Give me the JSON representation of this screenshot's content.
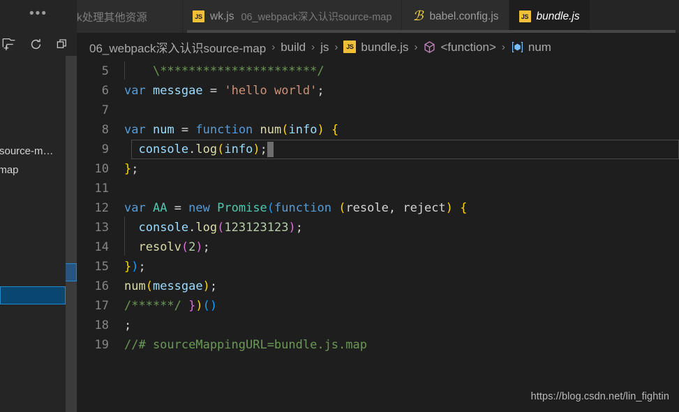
{
  "window": {
    "watermark": "https://blog.csdn.net/lin_fightin"
  },
  "tabbar": {
    "overflow_label": "…",
    "tabs": [
      {
        "icon": "none",
        "label": "k处理其他资源",
        "description": "",
        "active": false,
        "truncated": true
      },
      {
        "icon": "js-file-icon",
        "label": "wk.js",
        "description": "06_webpack深入认识source-map",
        "active": false,
        "truncated": false
      },
      {
        "icon": "babel-file-icon",
        "label": "babel.config.js",
        "description": "",
        "active": false,
        "truncated": false
      },
      {
        "icon": "js-file-icon",
        "label": "bundle.js",
        "description": "",
        "active": true,
        "truncated": true
      }
    ]
  },
  "breadcrumb": {
    "items": [
      {
        "label": "06_webpack深入认识source-map",
        "icon": "none"
      },
      {
        "label": "build",
        "icon": "none"
      },
      {
        "label": "js",
        "icon": "none"
      },
      {
        "label": "bundle.js",
        "icon": "js-file-icon"
      },
      {
        "label": "<function>",
        "icon": "cube-symbol-icon"
      },
      {
        "label": "num",
        "icon": "variable-symbol-icon"
      }
    ],
    "separator": "›"
  },
  "sidebar": {
    "actions": [
      {
        "name": "new-file-icon",
        "title": "New File"
      },
      {
        "name": "refresh-icon",
        "title": "Refresh Explorer"
      },
      {
        "name": "collapse-folders-icon",
        "title": "Collapse Folders"
      }
    ],
    "rows": [
      {
        "label": "及source-m…"
      },
      {
        "label": "e-map"
      }
    ],
    "selected_row_label": ""
  },
  "editor": {
    "first_line_number": 5,
    "lines": [
      {
        "num": "5",
        "indent_guide": true,
        "tokens": [
          {
            "text": "    ",
            "cls": "t-white"
          },
          {
            "text": "\\**********************/",
            "cls": "t-cmt"
          }
        ]
      },
      {
        "num": "6",
        "indent_guide": false,
        "tokens": [
          {
            "text": "var",
            "cls": "t-key"
          },
          {
            "text": " ",
            "cls": "t-white"
          },
          {
            "text": "messgae",
            "cls": "t-var"
          },
          {
            "text": " = ",
            "cls": "t-white"
          },
          {
            "text": "'hello world'",
            "cls": "t-str"
          },
          {
            "text": ";",
            "cls": "t-white"
          }
        ]
      },
      {
        "num": "7",
        "indent_guide": false,
        "tokens": []
      },
      {
        "num": "8",
        "indent_guide": false,
        "tokens": [
          {
            "text": "var",
            "cls": "t-key"
          },
          {
            "text": " ",
            "cls": "t-white"
          },
          {
            "text": "num",
            "cls": "t-var"
          },
          {
            "text": " = ",
            "cls": "t-white"
          },
          {
            "text": "function",
            "cls": "t-key"
          },
          {
            "text": " ",
            "cls": "t-white"
          },
          {
            "text": "num",
            "cls": "t-fn"
          },
          {
            "text": "(",
            "cls": "t-p-yellow"
          },
          {
            "text": "info",
            "cls": "t-param"
          },
          {
            "text": ")",
            "cls": "t-p-yellow"
          },
          {
            "text": " ",
            "cls": "t-white"
          },
          {
            "text": "{",
            "cls": "t-p-yellow"
          }
        ]
      },
      {
        "num": "9",
        "indent_guide": false,
        "current_line": true,
        "cursor": true,
        "tokens": [
          {
            "text": "  ",
            "cls": "t-white"
          },
          {
            "text": "console",
            "cls": "t-var"
          },
          {
            "text": ".",
            "cls": "t-white"
          },
          {
            "text": "log",
            "cls": "t-fn"
          },
          {
            "text": "(",
            "cls": "t-p-yellow"
          },
          {
            "text": "info",
            "cls": "t-var"
          },
          {
            "text": ")",
            "cls": "t-p-yellow"
          },
          {
            "text": ";",
            "cls": "t-white"
          }
        ]
      },
      {
        "num": "10",
        "indent_guide": false,
        "highlight": true,
        "tokens": [
          {
            "text": "}",
            "cls": "t-p-yellow"
          },
          {
            "text": ";",
            "cls": "t-white"
          }
        ]
      },
      {
        "num": "11",
        "indent_guide": false,
        "tokens": []
      },
      {
        "num": "12",
        "indent_guide": false,
        "tokens": [
          {
            "text": "var",
            "cls": "t-key"
          },
          {
            "text": " ",
            "cls": "t-white"
          },
          {
            "text": "AA",
            "cls": "t-cls"
          },
          {
            "text": " = ",
            "cls": "t-white"
          },
          {
            "text": "new",
            "cls": "t-key"
          },
          {
            "text": " ",
            "cls": "t-white"
          },
          {
            "text": "Promise",
            "cls": "t-cls"
          },
          {
            "text": "(",
            "cls": "t-p-blue"
          },
          {
            "text": "function",
            "cls": "t-key"
          },
          {
            "text": " ",
            "cls": "t-white"
          },
          {
            "text": "(",
            "cls": "t-p-yellow"
          },
          {
            "text": "resole",
            "cls": "t-white"
          },
          {
            "text": ", ",
            "cls": "t-white"
          },
          {
            "text": "reject",
            "cls": "t-white"
          },
          {
            "text": ")",
            "cls": "t-p-yellow"
          },
          {
            "text": " ",
            "cls": "t-white"
          },
          {
            "text": "{",
            "cls": "t-p-yellow"
          }
        ]
      },
      {
        "num": "13",
        "indent_guide": true,
        "tokens": [
          {
            "text": "  ",
            "cls": "t-white"
          },
          {
            "text": "console",
            "cls": "t-var"
          },
          {
            "text": ".",
            "cls": "t-white"
          },
          {
            "text": "log",
            "cls": "t-fn"
          },
          {
            "text": "(",
            "cls": "t-p-pink"
          },
          {
            "text": "123123123",
            "cls": "t-num"
          },
          {
            "text": ")",
            "cls": "t-p-pink"
          },
          {
            "text": ";",
            "cls": "t-white"
          }
        ]
      },
      {
        "num": "14",
        "indent_guide": true,
        "tokens": [
          {
            "text": "  ",
            "cls": "t-white"
          },
          {
            "text": "resolv",
            "cls": "t-fn"
          },
          {
            "text": "(",
            "cls": "t-p-pink"
          },
          {
            "text": "2",
            "cls": "t-num"
          },
          {
            "text": ")",
            "cls": "t-p-pink"
          },
          {
            "text": ";",
            "cls": "t-white"
          }
        ]
      },
      {
        "num": "15",
        "indent_guide": false,
        "tokens": [
          {
            "text": "}",
            "cls": "t-p-yellow"
          },
          {
            "text": ")",
            "cls": "t-p-blue"
          },
          {
            "text": ";",
            "cls": "t-white"
          }
        ]
      },
      {
        "num": "16",
        "indent_guide": false,
        "tokens": [
          {
            "text": "num",
            "cls": "t-fn"
          },
          {
            "text": "(",
            "cls": "t-p-yellow"
          },
          {
            "text": "messgae",
            "cls": "t-var"
          },
          {
            "text": ")",
            "cls": "t-p-yellow"
          },
          {
            "text": ";",
            "cls": "t-white"
          }
        ]
      },
      {
        "num": "17",
        "indent_guide": false,
        "tokens": [
          {
            "text": "/******/",
            "cls": "t-cmt"
          },
          {
            "text": " ",
            "cls": "t-white"
          },
          {
            "text": "}",
            "cls": "t-p-pink"
          },
          {
            "text": ")",
            "cls": "t-p-yellow"
          },
          {
            "text": "(",
            "cls": "t-p-blue"
          },
          {
            "text": ")",
            "cls": "t-p-blue"
          }
        ]
      },
      {
        "num": "18",
        "indent_guide": false,
        "tokens": [
          {
            "text": ";",
            "cls": "t-white"
          }
        ]
      },
      {
        "num": "19",
        "indent_guide": false,
        "tokens": [
          {
            "text": "//# sourceMappingURL=bundle.js.map",
            "cls": "t-cmt"
          }
        ]
      }
    ]
  },
  "colors": {
    "editor_background": "#1e1e1e",
    "tabbar_background": "#252526",
    "inactive_tab": "#2d2d2d",
    "selection_blue": "#094771",
    "selection_border": "#1f8ad2",
    "js_icon_yellow": "#f0c039",
    "comment_green": "#6a9955",
    "keyword_blue": "#569cd6",
    "string_orange": "#ce9178",
    "function_yellow": "#dcdcaa",
    "variable_lightblue": "#9cdcfe",
    "number_green": "#b5cea8",
    "class_teal": "#4ec9b0"
  }
}
